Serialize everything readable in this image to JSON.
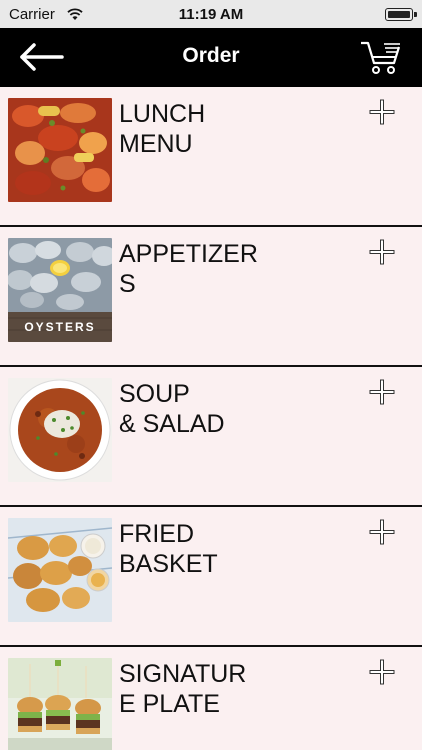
{
  "status_bar": {
    "carrier": "Carrier",
    "time": "11:19 AM"
  },
  "header": {
    "title": "Order",
    "back_icon": "arrow-left-icon",
    "cart_icon": "cart-icon"
  },
  "menu_items": [
    {
      "label": "LUNCH\nMENU",
      "image": "lunch-photo",
      "action_icon": "plus-icon"
    },
    {
      "label": "APPETIZERS",
      "image": "oysters-photo",
      "image_text": "OYSTERS",
      "action_icon": "plus-icon"
    },
    {
      "label": "SOUP\n& SALAD",
      "image": "soup-photo",
      "action_icon": "plus-icon"
    },
    {
      "label": "FRIED\nBASKET",
      "image": "fried-shrimp-photo",
      "action_icon": "plus-icon"
    },
    {
      "label": "SIGNATURE PLATE",
      "image": "sliders-photo",
      "action_icon": "plus-icon"
    }
  ],
  "colors": {
    "nav_bg": "#000000",
    "row_bg": "#fbf0f1",
    "status_bg": "#e9e9e9",
    "divider": "#111111"
  }
}
